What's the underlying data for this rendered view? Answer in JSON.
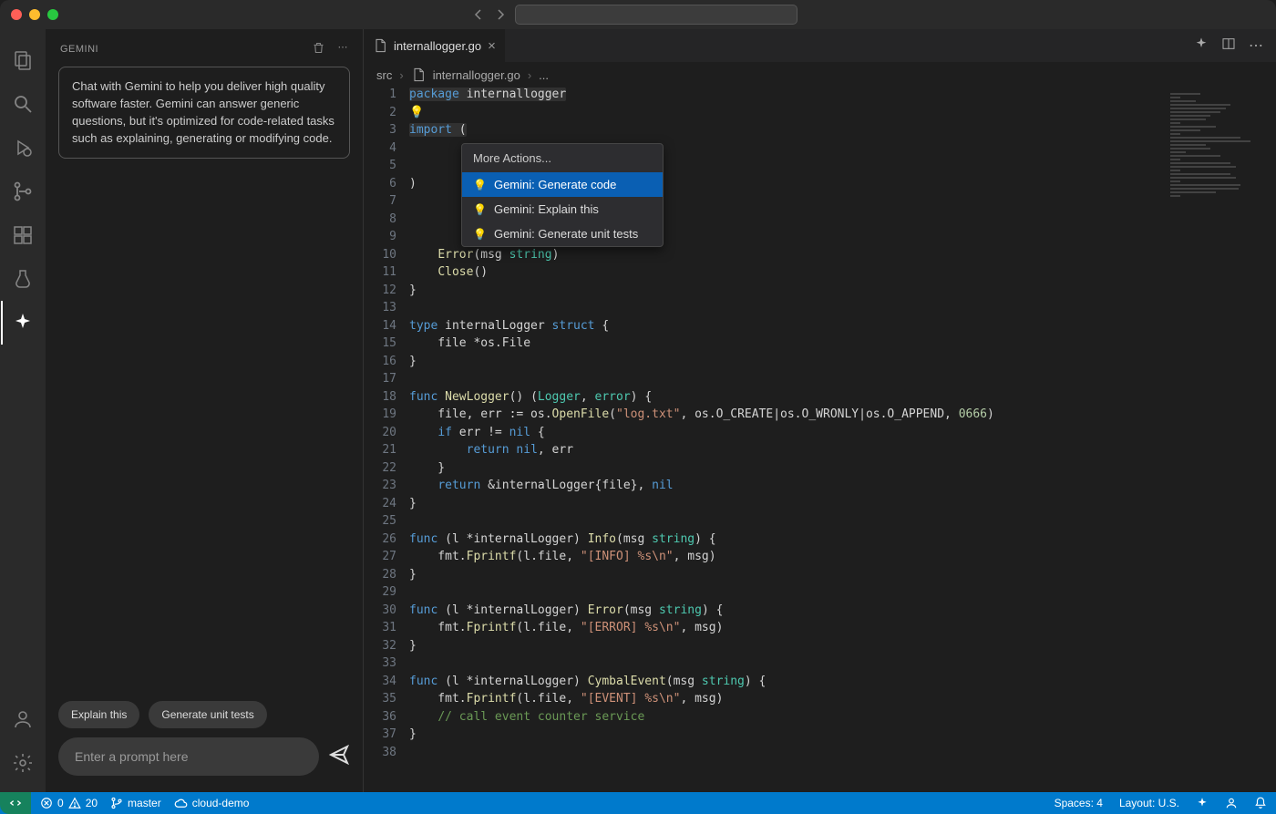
{
  "titlebar": {},
  "sidebar": {
    "title": "GEMINI",
    "hint": "Chat with Gemini to help you deliver high quality software faster. Gemini can answer generic questions, but it's optimized for code-related tasks such as explaining, generating or modifying code.",
    "quick_actions": {
      "explain": "Explain this",
      "unit_tests": "Generate unit tests"
    },
    "prompt_placeholder": "Enter a prompt here"
  },
  "tab": {
    "filename": "internallogger.go"
  },
  "breadcrumbs": {
    "seg0": "src",
    "seg1": "internallogger.go",
    "seg2": "..."
  },
  "code_menu": {
    "header": "More Actions...",
    "items": [
      "Gemini: Generate code",
      "Gemini: Explain this",
      "Gemini: Generate unit tests"
    ]
  },
  "code_lines": [
    {
      "n": 1,
      "tokens": [
        [
          "k",
          "package"
        ],
        [
          "p",
          " "
        ],
        [
          "id",
          "internallogger"
        ]
      ],
      "hl": true
    },
    {
      "n": 2,
      "tokens": [
        [
          "bulb",
          "💡"
        ]
      ]
    },
    {
      "n": 3,
      "tokens": [
        [
          "k",
          "import"
        ],
        [
          "p",
          " ("
        ]
      ],
      "hl": true
    },
    {
      "n": 4,
      "tokens": []
    },
    {
      "n": 5,
      "tokens": []
    },
    {
      "n": 6,
      "tokens": [
        [
          "p",
          ")"
        ]
      ]
    },
    {
      "n": 7,
      "tokens": []
    },
    {
      "n": 8,
      "tokens": []
    },
    {
      "n": 9,
      "tokens": []
    },
    {
      "n": 10,
      "tokens": [
        [
          "p",
          "    "
        ],
        [
          "fn",
          "Error"
        ],
        [
          "p",
          "("
        ],
        [
          "id",
          "msg"
        ],
        [
          "p",
          " "
        ],
        [
          "t",
          "string"
        ],
        [
          "p",
          ")"
        ]
      ]
    },
    {
      "n": 11,
      "tokens": [
        [
          "p",
          "    "
        ],
        [
          "fn",
          "Close"
        ],
        [
          "p",
          "()"
        ]
      ]
    },
    {
      "n": 12,
      "tokens": [
        [
          "p",
          "}"
        ]
      ]
    },
    {
      "n": 13,
      "tokens": []
    },
    {
      "n": 14,
      "tokens": [
        [
          "k",
          "type"
        ],
        [
          "p",
          " "
        ],
        [
          "id",
          "internalLogger"
        ],
        [
          "p",
          " "
        ],
        [
          "k",
          "struct"
        ],
        [
          "p",
          " {"
        ]
      ]
    },
    {
      "n": 15,
      "tokens": [
        [
          "p",
          "    file *os.File"
        ]
      ]
    },
    {
      "n": 16,
      "tokens": [
        [
          "p",
          "}"
        ]
      ]
    },
    {
      "n": 17,
      "tokens": []
    },
    {
      "n": 18,
      "tokens": [
        [
          "k",
          "func"
        ],
        [
          "p",
          " "
        ],
        [
          "fn",
          "NewLogger"
        ],
        [
          "p",
          "() ("
        ],
        [
          "t",
          "Logger"
        ],
        [
          "p",
          ", "
        ],
        [
          "t",
          "error"
        ],
        [
          "p",
          ") {"
        ]
      ]
    },
    {
      "n": 19,
      "tokens": [
        [
          "p",
          "    file, err := os."
        ],
        [
          "fn",
          "OpenFile"
        ],
        [
          "p",
          "("
        ],
        [
          "s",
          "\"log.txt\""
        ],
        [
          "p",
          ", os.O_CREATE|os.O_WRONLY|os.O_APPEND, "
        ],
        [
          "n",
          "0666"
        ],
        [
          "p",
          ")"
        ]
      ]
    },
    {
      "n": 20,
      "tokens": [
        [
          "p",
          "    "
        ],
        [
          "k",
          "if"
        ],
        [
          "p",
          " err != "
        ],
        [
          "k",
          "nil"
        ],
        [
          "p",
          " {"
        ]
      ]
    },
    {
      "n": 21,
      "tokens": [
        [
          "p",
          "        "
        ],
        [
          "k",
          "return"
        ],
        [
          "p",
          " "
        ],
        [
          "k",
          "nil"
        ],
        [
          "p",
          ", err"
        ]
      ]
    },
    {
      "n": 22,
      "tokens": [
        [
          "p",
          "    }"
        ]
      ]
    },
    {
      "n": 23,
      "tokens": [
        [
          "p",
          "    "
        ],
        [
          "k",
          "return"
        ],
        [
          "p",
          " &internalLogger{file}, "
        ],
        [
          "k",
          "nil"
        ]
      ]
    },
    {
      "n": 24,
      "tokens": [
        [
          "p",
          "}"
        ]
      ]
    },
    {
      "n": 25,
      "tokens": []
    },
    {
      "n": 26,
      "tokens": [
        [
          "k",
          "func"
        ],
        [
          "p",
          " (l *internalLogger) "
        ],
        [
          "fn",
          "Info"
        ],
        [
          "p",
          "(msg "
        ],
        [
          "t",
          "string"
        ],
        [
          "p",
          ") {"
        ]
      ]
    },
    {
      "n": 27,
      "tokens": [
        [
          "p",
          "    fmt."
        ],
        [
          "fn",
          "Fprintf"
        ],
        [
          "p",
          "(l.file, "
        ],
        [
          "s",
          "\"[INFO] %s\\n\""
        ],
        [
          "p",
          ", msg)"
        ]
      ]
    },
    {
      "n": 28,
      "tokens": [
        [
          "p",
          "}"
        ]
      ]
    },
    {
      "n": 29,
      "tokens": []
    },
    {
      "n": 30,
      "tokens": [
        [
          "k",
          "func"
        ],
        [
          "p",
          " (l *internalLogger) "
        ],
        [
          "fn",
          "Error"
        ],
        [
          "p",
          "(msg "
        ],
        [
          "t",
          "string"
        ],
        [
          "p",
          ") {"
        ]
      ]
    },
    {
      "n": 31,
      "tokens": [
        [
          "p",
          "    fmt."
        ],
        [
          "fn",
          "Fprintf"
        ],
        [
          "p",
          "(l.file, "
        ],
        [
          "s",
          "\"[ERROR] %s\\n\""
        ],
        [
          "p",
          ", msg)"
        ]
      ]
    },
    {
      "n": 32,
      "tokens": [
        [
          "p",
          "}"
        ]
      ]
    },
    {
      "n": 33,
      "tokens": []
    },
    {
      "n": 34,
      "tokens": [
        [
          "k",
          "func"
        ],
        [
          "p",
          " (l *internalLogger) "
        ],
        [
          "fn",
          "CymbalEvent"
        ],
        [
          "p",
          "(msg "
        ],
        [
          "t",
          "string"
        ],
        [
          "p",
          ") {"
        ]
      ]
    },
    {
      "n": 35,
      "tokens": [
        [
          "p",
          "    fmt."
        ],
        [
          "fn",
          "Fprintf"
        ],
        [
          "p",
          "(l.file, "
        ],
        [
          "s",
          "\"[EVENT] %s\\n\""
        ],
        [
          "p",
          ", msg)"
        ]
      ]
    },
    {
      "n": 36,
      "tokens": [
        [
          "p",
          "    "
        ],
        [
          "c",
          "// call event counter service"
        ]
      ]
    },
    {
      "n": 37,
      "tokens": [
        [
          "p",
          "}"
        ]
      ]
    },
    {
      "n": 38,
      "tokens": []
    }
  ],
  "status": {
    "errors": "0",
    "warnings": "20",
    "branch": "master",
    "cloud": "cloud-demo",
    "spaces": "Spaces: 4",
    "layout": "Layout: U.S."
  }
}
